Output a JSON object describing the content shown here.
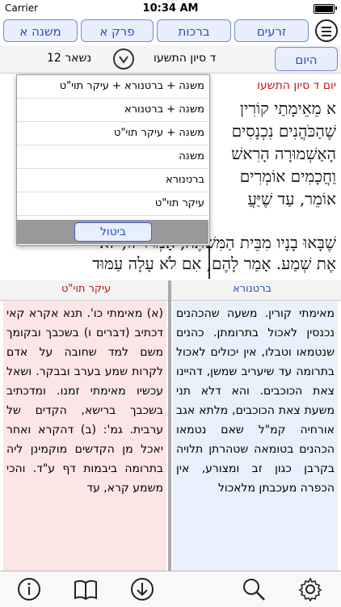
{
  "status": {
    "carrier": "Carrier",
    "time": "10:34 AM"
  },
  "tabs": {
    "mishna": "משנה א",
    "perek": "פרק א",
    "brachot": "ברכות",
    "zraim": "זרעים"
  },
  "toolbar": {
    "today": "היום",
    "date": "ד סיון התשעו",
    "remaining": "נשאר 12"
  },
  "main": {
    "day_title": "יום ד סיון התשעו",
    "lines": [
      "א מֵאֵימָתַי קוֹרִין",
      "שֶׁהַכֹּהֲנִים נִכְנָסִים",
      "הָאַשְׁמוּרָה הָרִאשׁ",
      "וַחֲכָמִים אוֹמְרִים",
      "אוֹמֵר, עַד שֶׁיַּעֲ",
      "שֶׁבָּאוּ בָנָיו מִבֵּית הַמִּשְׁתֶּה, אָמְרוּ לוֹ, לֹא",
      "אֶת שְׁמַע. אָמַר לָהֶם, אִם לֹא עָלָה עַמּוּד"
    ]
  },
  "popup": {
    "options": [
      "משנה + ברטנורא + עיקר תוי\"ט",
      "משנה + ברטנורא",
      "משנה + עיקר תוי\"ט",
      "משנה",
      "ברטנורא",
      "עיקר תוי\"ט"
    ],
    "cancel": "ביטול"
  },
  "columns": {
    "left_title": "עיקר תוי\"ט",
    "right_title": "ברטנורא",
    "left_text": "(א) מאימתי כו'. תנא אקרא קאי דכתיב (דברים ו) בשכבך ובקומך משם למד שחובה על אדם לקרות שמע בערב ובבקר. ושאל עכשיו מאימתי זמנו. ומדכתיב בשכבך ברישא, הקדים של ערבית. גמ': (ב) דהקרא ואחר יאכל מן הקדשים מוקמינן ליה בתרומה ביבמות דף ע\"ד. והכי משמע קרא, עד",
    "right_text": "מאימתי קורין. משעה שהכהנים נכנסין לאכול בתרומתן. כהנים שנטמאו וטבלו, אין יכולים לאכול בתרומה עד שיעריב שמשן, דהיינו צאת הכוכבים. והא דלא תני משעת צאת הכוכבים, מלתא אגב אורחיה קמ\"ל שאם נטמאו הכהנים בטומאה שטהרתן תלויה בקרבן כגון זב ומצורע, אין הכפרה מעכבתן מלאכול"
  },
  "bottom": {
    "icons": [
      "info-icon",
      "book-icon",
      "download-icon",
      "search-icon",
      "gear-icon"
    ]
  }
}
